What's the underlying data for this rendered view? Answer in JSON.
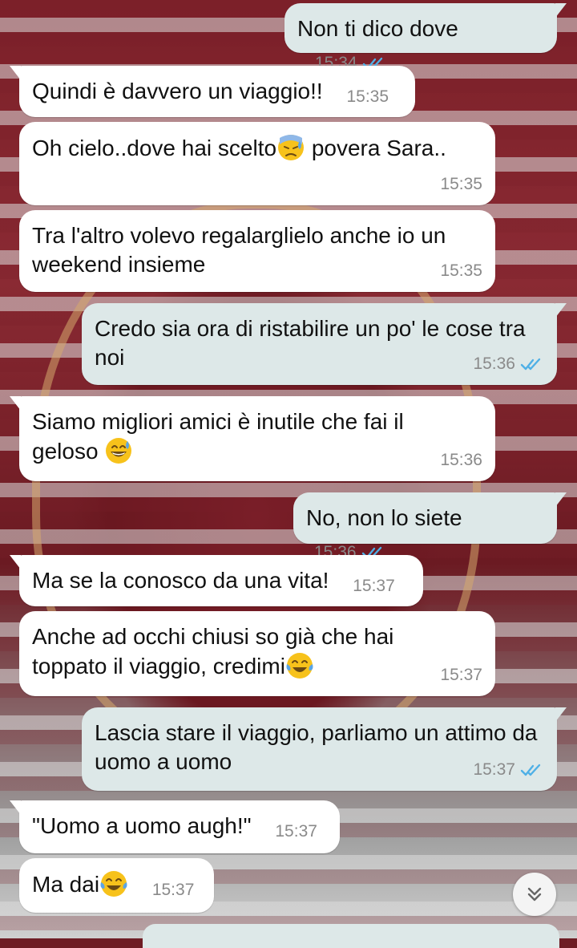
{
  "messages": [
    {
      "dir": "out",
      "text": "Non ti dico dove",
      "time": "15:34",
      "read": true
    },
    {
      "dir": "in",
      "text": "Quindi è davvero un viaggio!!",
      "time": "15:35"
    },
    {
      "dir": "in",
      "text": "Oh cielo..dove hai scelto",
      "text_after": " povera Sara..",
      "emoji": "sweat-face",
      "time": "15:35"
    },
    {
      "dir": "in",
      "text": "Tra l'altro volevo regalarglielo anche io un weekend insieme",
      "time": "15:35"
    },
    {
      "dir": "out",
      "text": "Credo sia ora di ristabilire un po' le cose tra noi",
      "time": "15:36",
      "read": true
    },
    {
      "dir": "in",
      "text": "Siamo migliori amici è inutile che fai il geloso ",
      "emoji": "grin-sweat",
      "time": "15:36"
    },
    {
      "dir": "out",
      "text": "No, non lo siete",
      "time": "15:36",
      "read": true
    },
    {
      "dir": "in",
      "text": "Ma se la conosco da una vita!",
      "time": "15:37"
    },
    {
      "dir": "in",
      "text": "Anche ad occhi chiusi so già che hai toppato il viaggio, credimi",
      "emoji": "tears-of-joy",
      "time": "15:37"
    },
    {
      "dir": "out",
      "text": "Lascia stare il viaggio, parliamo un attimo da uomo a uomo",
      "time": "15:37",
      "read": true
    },
    {
      "dir": "in",
      "text": "\"Uomo a uomo augh!\"",
      "time": "15:37"
    },
    {
      "dir": "in",
      "text": "Ma dai",
      "emoji": "tears-of-joy",
      "time": "15:37"
    }
  ],
  "colors": {
    "incoming_bubble": "#ffffff",
    "outgoing_bubble": "#dde8e8",
    "read_ticks": "#4fb0e6",
    "timestamp": "#8a8a8a"
  },
  "icons": {
    "scroll_down": "double-chevron-down-icon",
    "read_receipt": "double-check-icon"
  }
}
